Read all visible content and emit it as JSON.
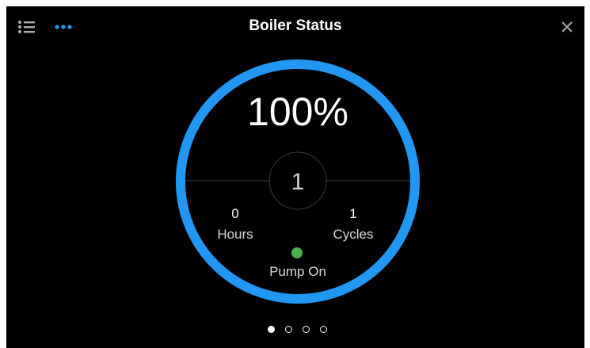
{
  "header": {
    "title": "Boiler Status",
    "menu_icon": "list-icon",
    "more_icon": "more-dots-icon",
    "close_icon": "close-icon"
  },
  "gauge": {
    "percent_label": "100%",
    "level": 1.0,
    "center_value": "1",
    "ring_color": "#2196f3"
  },
  "stats": {
    "hours": {
      "value": "0",
      "label": "Hours"
    },
    "cycles": {
      "value": "1",
      "label": "Cycles"
    }
  },
  "pump": {
    "label": "Pump On",
    "status_color": "#4caf50"
  },
  "pagination": {
    "total": 4,
    "active": 1
  }
}
